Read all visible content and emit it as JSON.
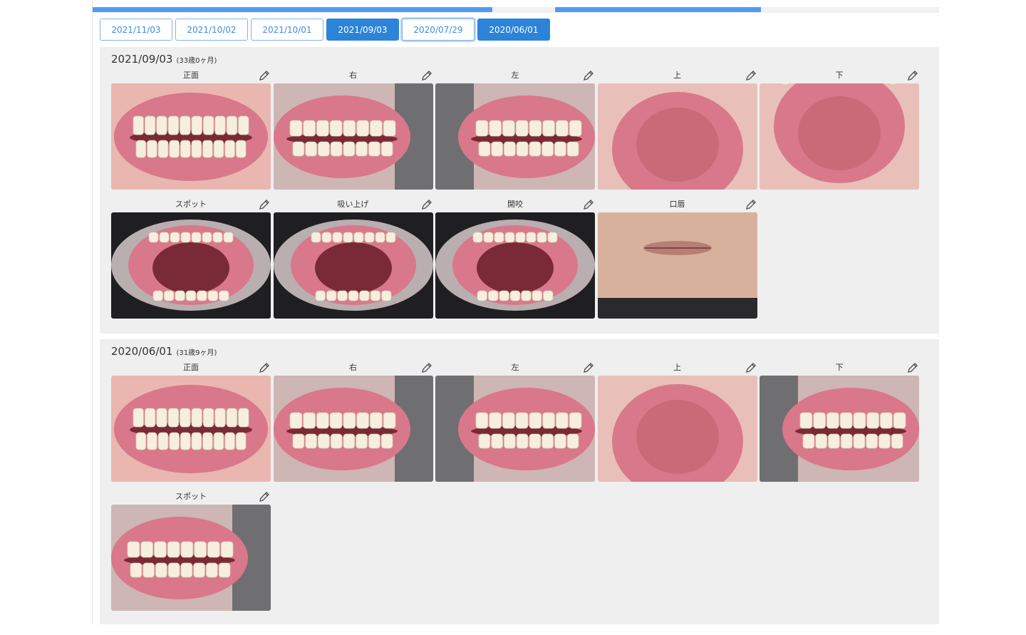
{
  "date_tabs": [
    {
      "label": "2021/11/03",
      "state": "default"
    },
    {
      "label": "2021/10/02",
      "state": "default"
    },
    {
      "label": "2021/10/01",
      "state": "default"
    },
    {
      "label": "2021/09/03",
      "state": "selected"
    },
    {
      "label": "2020/07/29",
      "state": "focused"
    },
    {
      "label": "2020/06/01",
      "state": "selected"
    }
  ],
  "sessions": [
    {
      "date": "2021/09/03",
      "age": "(33歳0ヶ月)",
      "photos": [
        {
          "label": "正面",
          "kind": "front-occlusion"
        },
        {
          "label": "右",
          "kind": "right-occlusion"
        },
        {
          "label": "左",
          "kind": "left-occlusion"
        },
        {
          "label": "上",
          "kind": "upper-arch"
        },
        {
          "label": "下",
          "kind": "lower-arch"
        },
        {
          "label": "スポット",
          "kind": "open-mouth"
        },
        {
          "label": "吸い上げ",
          "kind": "open-mouth"
        },
        {
          "label": "開咬",
          "kind": "open-mouth"
        },
        {
          "label": "口唇",
          "kind": "lips-face"
        }
      ]
    },
    {
      "date": "2020/06/01",
      "age": "(31歳9ヶ月)",
      "photos": [
        {
          "label": "正面",
          "kind": "front-occlusion"
        },
        {
          "label": "右",
          "kind": "right-occlusion"
        },
        {
          "label": "左",
          "kind": "left-occlusion"
        },
        {
          "label": "上",
          "kind": "upper-arch"
        },
        {
          "label": "下",
          "kind": "left-occlusion"
        },
        {
          "label": "スポット",
          "kind": "right-occlusion"
        }
      ]
    }
  ],
  "icons": {
    "edit": "pencil-icon"
  },
  "colors": {
    "accent": "#2b84d8",
    "progress": "#4d9cf2",
    "section_bg": "#efefef",
    "gum": "#d9788a",
    "tooth": "#f6efe0",
    "mouth_dark": "#7a2a36"
  }
}
